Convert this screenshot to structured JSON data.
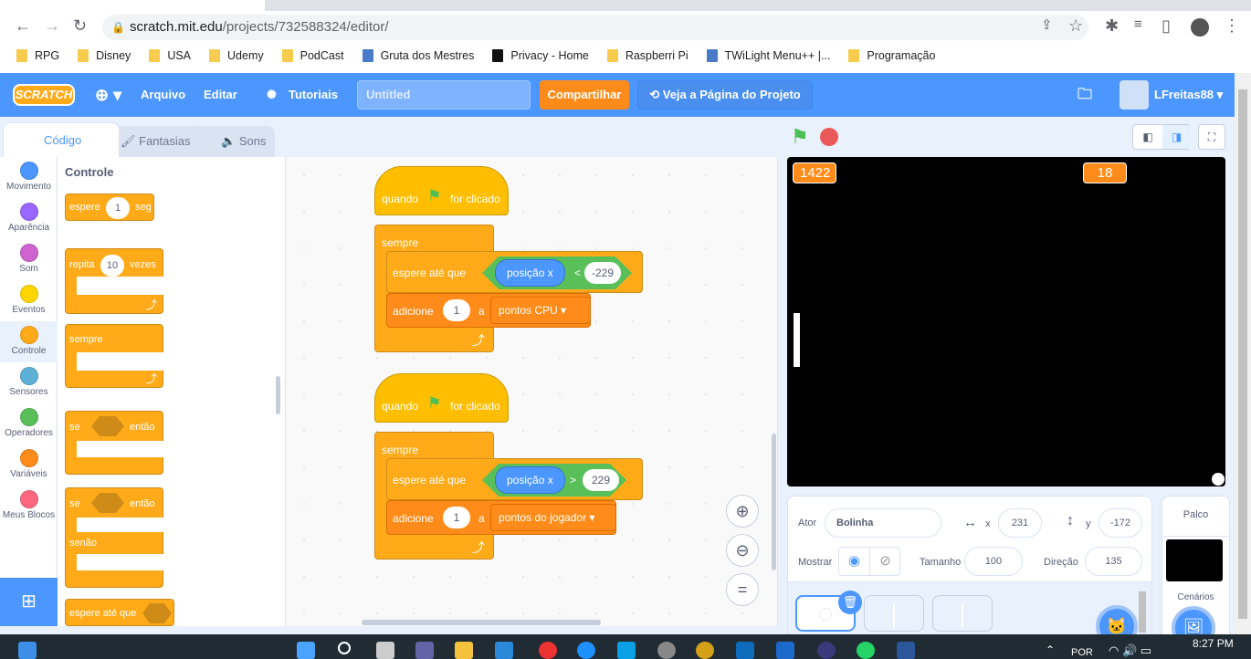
{
  "browser": {
    "url_host": "scratch.mit.edu",
    "url_path": "/projects/732588324/editor/",
    "bookmarks": [
      {
        "label": "RPG",
        "icon": "folder-icon"
      },
      {
        "label": "Disney",
        "icon": "folder-icon"
      },
      {
        "label": "USA",
        "icon": "folder-icon"
      },
      {
        "label": "Udemy",
        "icon": "folder-icon"
      },
      {
        "label": "PodCast",
        "icon": "folder-icon"
      },
      {
        "label": "Gruta dos Mestres",
        "icon": "site-icon"
      },
      {
        "label": "Privacy - Home",
        "icon": "p-icon"
      },
      {
        "label": "Raspberri Pi",
        "icon": "folder-icon"
      },
      {
        "label": "TWiLight Menu++ |...",
        "icon": "site-icon"
      },
      {
        "label": "Programação",
        "icon": "folder-icon"
      }
    ]
  },
  "menubar": {
    "logo": "SCRATCH",
    "file": "Arquivo",
    "edit": "Editar",
    "tutorials": "Tutoriais",
    "title": "Untitled",
    "share": "Compartilhar",
    "see_project": "Veja a Página do Projeto",
    "user": "LFreitas88"
  },
  "tabs": {
    "code": "Código",
    "costumes": "Fantasias",
    "sounds": "Sons"
  },
  "categories": [
    {
      "label": "Movimento",
      "color": "#4c97ff"
    },
    {
      "label": "Aparência",
      "color": "#9966ff"
    },
    {
      "label": "Som",
      "color": "#cf63cf"
    },
    {
      "label": "Eventos",
      "color": "#ffd500"
    },
    {
      "label": "Controle",
      "color": "#ffab19"
    },
    {
      "label": "Sensores",
      "color": "#5cb1d6"
    },
    {
      "label": "Operadores",
      "color": "#59c059"
    },
    {
      "label": "Variáveis",
      "color": "#ff8c1a"
    },
    {
      "label": "Meus Blocos",
      "color": "#ff6680"
    }
  ],
  "palette": {
    "heading": "Controle",
    "wait": "espere",
    "wait_val": "1",
    "wait_unit": "seg",
    "repeat": "repita",
    "repeat_val": "10",
    "repeat_unit": "vezes",
    "forever": "sempre",
    "if": "se",
    "then": "então",
    "if2": "se",
    "then2": "então",
    "else": "senão",
    "wait_until": "espere até que"
  },
  "scripts": [
    {
      "hat": "quando",
      "hat2": "for clicado",
      "forever": "sempre",
      "wait_until": "espere até que",
      "reporter": "posição x",
      "op": "<",
      "value": "-229",
      "change": "adicione",
      "change_val": "1",
      "to": "a",
      "variable": "pontos CPU"
    },
    {
      "hat": "quando",
      "hat2": "for clicado",
      "forever": "sempre",
      "wait_until": "espere até que",
      "reporter": "posição x",
      "op": ">",
      "value": "229",
      "change": "adicione",
      "change_val": "1",
      "to": "a",
      "variable": "pontos do jogador"
    }
  ],
  "stage": {
    "monitors": [
      "1422",
      "18"
    ]
  },
  "sprite_info": {
    "sprite_label": "Ator",
    "sprite_name": "Bolinha",
    "x_label": "x",
    "x": "231",
    "y_label": "y",
    "y": "-172",
    "show_label": "Mostrar",
    "size_label": "Tamanho",
    "size": "100",
    "direction_label": "Direção",
    "direction": "135"
  },
  "stage_panel": {
    "title": "Palco",
    "backdrops": "Cenários"
  },
  "taskbar": {
    "lang": "POR",
    "time": "8:27 PM"
  }
}
